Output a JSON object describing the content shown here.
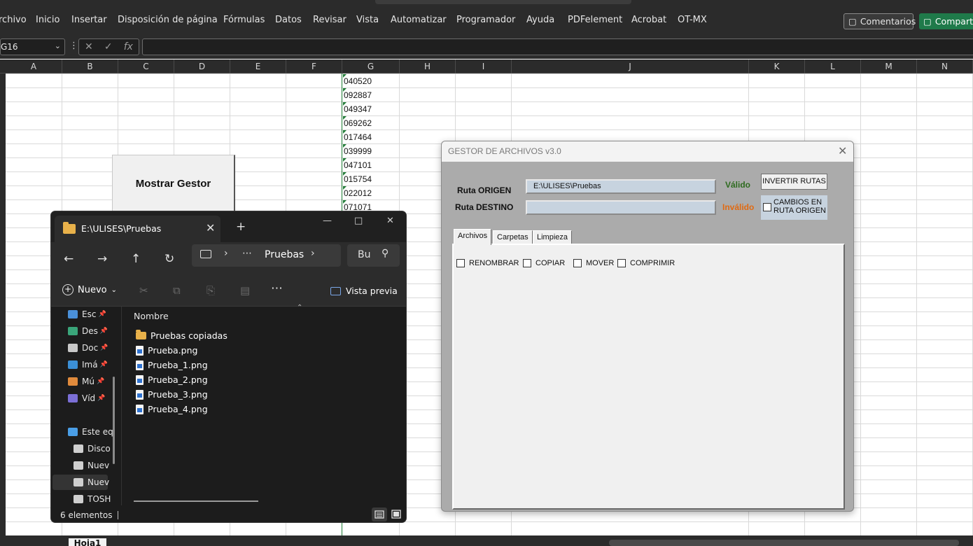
{
  "excel": {
    "menu": [
      "rchivo",
      "Inicio",
      "Insertar",
      "Disposición de página",
      "Fórmulas",
      "Datos",
      "Revisar",
      "Vista",
      "Automatizar",
      "Programador",
      "Ayuda",
      "PDFelement",
      "Acrobat",
      "OT-MX"
    ],
    "comments_label": "Comentarios",
    "share_label": "Comparti",
    "name_box": "G16",
    "fx_label": "fx",
    "columns": [
      "A",
      "B",
      "C",
      "D",
      "E",
      "F",
      "G",
      "H",
      "I",
      "J",
      "K",
      "L",
      "M",
      "N"
    ],
    "column_g_values": [
      "040520",
      "092887",
      "049347",
      "069262",
      "017464",
      "039999",
      "047101",
      "015754",
      "022012",
      "071071"
    ],
    "mostrar_button": "Mostrar Gestor",
    "sheet_tab": "Hoja1",
    "accent_color": "#1e7b34"
  },
  "explorer": {
    "tab_title": "E:\\ULISES\\Pruebas",
    "breadcrumb": "Pruebas",
    "search_placeholder": "Bu",
    "new_label": "Nuevo",
    "preview_label": "Vista previa",
    "column_name": "Nombre",
    "sidebar": [
      {
        "label": "Esc",
        "icon": "desktop-icon",
        "pinned": true
      },
      {
        "label": "Des",
        "icon": "download-icon",
        "pinned": true
      },
      {
        "label": "Doc",
        "icon": "documents-icon",
        "pinned": true
      },
      {
        "label": "Imá",
        "icon": "pictures-icon",
        "pinned": true
      },
      {
        "label": "Mú",
        "icon": "music-icon",
        "pinned": true
      },
      {
        "label": "Víd",
        "icon": "videos-icon",
        "pinned": true
      },
      {
        "label": "Este eq",
        "icon": "this-pc-icon",
        "pinned": false
      },
      {
        "label": "Disco",
        "icon": "drive-icon",
        "pinned": false
      },
      {
        "label": "Nuev",
        "icon": "drive-icon",
        "pinned": false
      },
      {
        "label": "Nuev",
        "icon": "drive-icon",
        "pinned": false
      },
      {
        "label": "TOSH",
        "icon": "drive-icon",
        "pinned": false
      }
    ],
    "files": [
      {
        "name": "Pruebas copiadas",
        "type": "folder"
      },
      {
        "name": "Prueba.png",
        "type": "png"
      },
      {
        "name": "Prueba_1.png",
        "type": "png"
      },
      {
        "name": "Prueba_2.png",
        "type": "png"
      },
      {
        "name": "Prueba_3.png",
        "type": "png"
      },
      {
        "name": "Prueba_4.png",
        "type": "png"
      }
    ],
    "status": "6 elementos"
  },
  "gestor": {
    "title": "GESTOR DE ARCHIVOS v3.0",
    "origen_label": "Ruta ORIGEN",
    "origen_value": "E:\\ULISES\\Pruebas",
    "origen_status": "Válido",
    "destino_label": "Ruta DESTINO",
    "destino_value": "",
    "destino_status": "Inválido",
    "valid_color": "#2e6b1f",
    "invalid_color": "#e06a12",
    "invert_button": "INVERTIR RUTAS",
    "cambios_label_1": "CAMBIOS EN",
    "cambios_label_2": "RUTA ORIGEN",
    "tabs": [
      "Archivos",
      "Carpetas",
      "Limpieza"
    ],
    "options": [
      "RENOMBRAR",
      "COPIAR",
      "MOVER",
      "COMPRIMIR"
    ]
  }
}
